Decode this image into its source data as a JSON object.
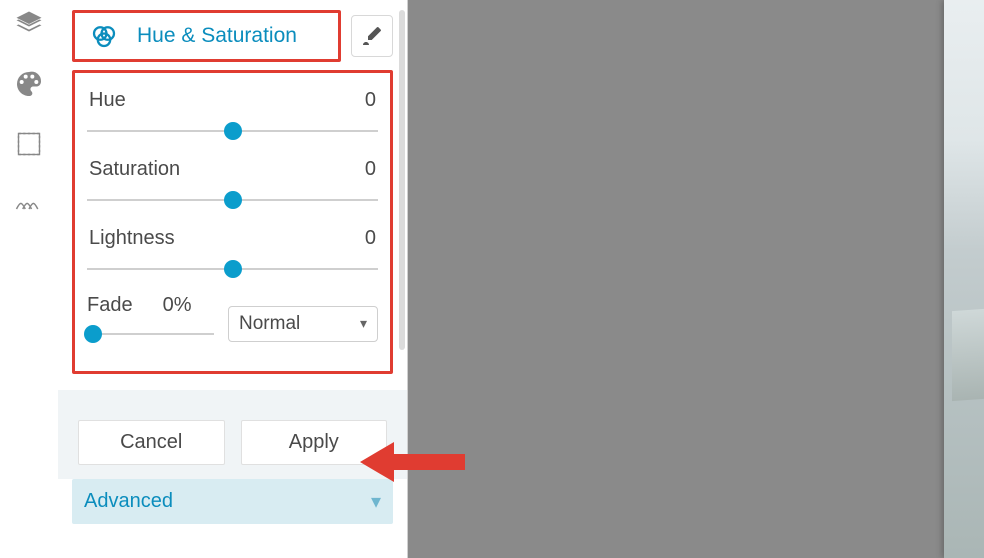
{
  "toolbar": {
    "tools": [
      {
        "name": "layers"
      },
      {
        "name": "palette"
      },
      {
        "name": "frame"
      },
      {
        "name": "scratches"
      }
    ]
  },
  "panel": {
    "title": "Hue & Saturation",
    "controls": {
      "hue": {
        "label": "Hue",
        "value": "0",
        "pos": 50
      },
      "saturation": {
        "label": "Saturation",
        "value": "0",
        "pos": 50
      },
      "lightness": {
        "label": "Lightness",
        "value": "0",
        "pos": 50
      },
      "fade": {
        "label": "Fade",
        "value": "0%",
        "pos": 5
      }
    },
    "blend_mode_selected": "Normal",
    "cancel_label": "Cancel",
    "apply_label": "Apply",
    "advanced_label": "Advanced"
  }
}
